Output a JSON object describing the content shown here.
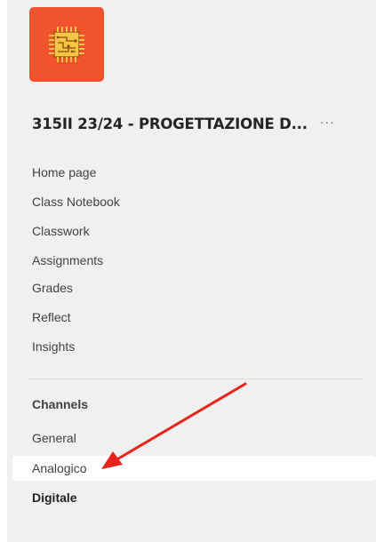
{
  "team": {
    "logo_icon": "circuit-chip-icon",
    "logo_bg_color": "#f0532d",
    "name": "315II 23/24 - PROGETTAZIONE D...",
    "more_label": "···"
  },
  "nav": {
    "items": [
      {
        "label": "Home page"
      },
      {
        "label": "Class Notebook"
      },
      {
        "label": "Classwork"
      },
      {
        "label": "Assignments"
      },
      {
        "label": "Grades"
      },
      {
        "label": "Reflect"
      },
      {
        "label": "Insights"
      }
    ]
  },
  "channels": {
    "heading": "Channels",
    "items": [
      {
        "label": "General",
        "selected": false,
        "bold": false
      },
      {
        "label": "Analogico",
        "selected": true,
        "bold": false
      },
      {
        "label": "Digitale",
        "selected": false,
        "bold": true
      }
    ]
  },
  "annotation": {
    "arrow_color": "#e8241a",
    "points_to": "Analogico"
  }
}
